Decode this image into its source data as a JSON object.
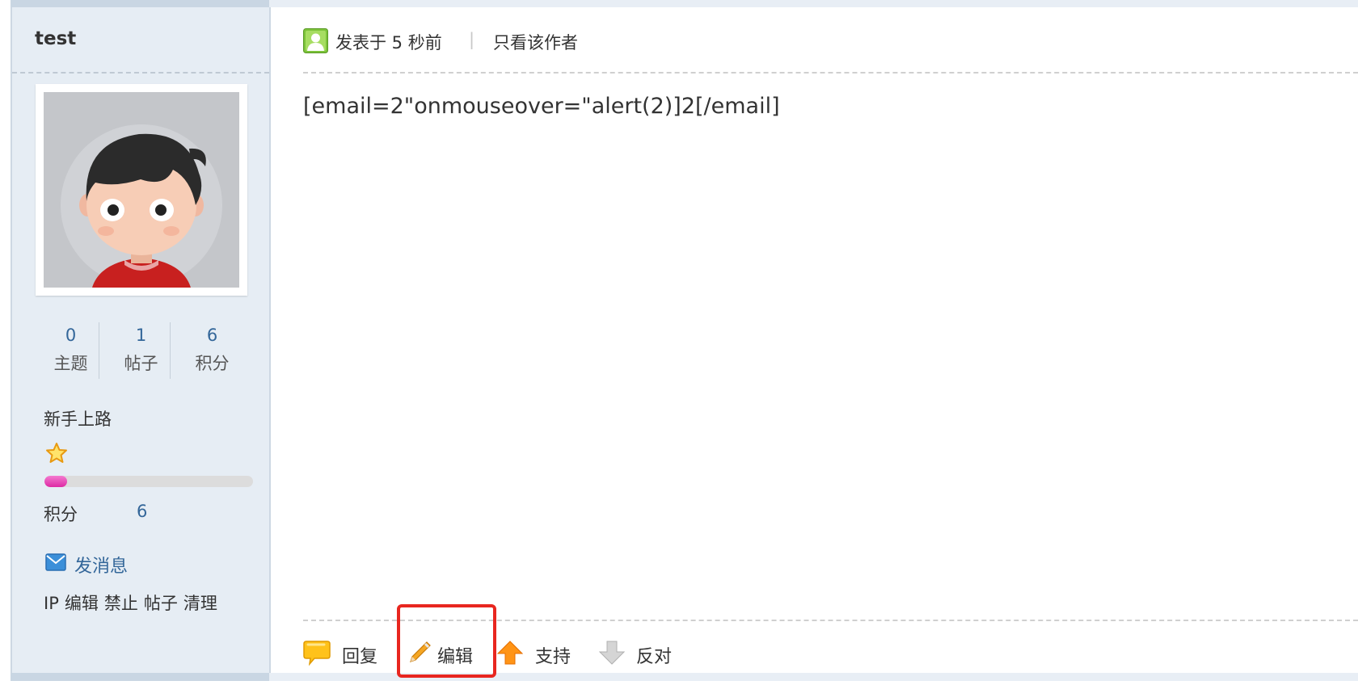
{
  "sidebar": {
    "username": "test",
    "stats": [
      {
        "value": "0",
        "label": "主题"
      },
      {
        "value": "1",
        "label": "帖子"
      },
      {
        "value": "6",
        "label": "积分"
      }
    ],
    "rank": "新手上路",
    "rank_progress_fraction": 0.11,
    "credit_label": "积分",
    "credit_value": "6",
    "send_message": "发消息",
    "admin_links": [
      "IP",
      "编辑",
      "禁止",
      "帖子",
      "清理"
    ]
  },
  "post": {
    "posted_time": "发表于 5 秒前",
    "separator": "|",
    "only_author": "只看该作者",
    "content": "[email=2\"onmouseover=\"alert(2)]2[/email]"
  },
  "actions": [
    {
      "icon": "speech-bubble-icon",
      "label": "回复"
    },
    {
      "icon": "pencil-icon",
      "label": "编辑"
    },
    {
      "icon": "arrow-up-icon",
      "label": "支持"
    },
    {
      "icon": "arrow-down-icon",
      "label": "反对"
    }
  ],
  "colors": {
    "sidebar_bg": "#e6edf4",
    "link_blue": "#336699",
    "highlight_red": "#e8261f",
    "progress_pink": "#e63bb0"
  }
}
